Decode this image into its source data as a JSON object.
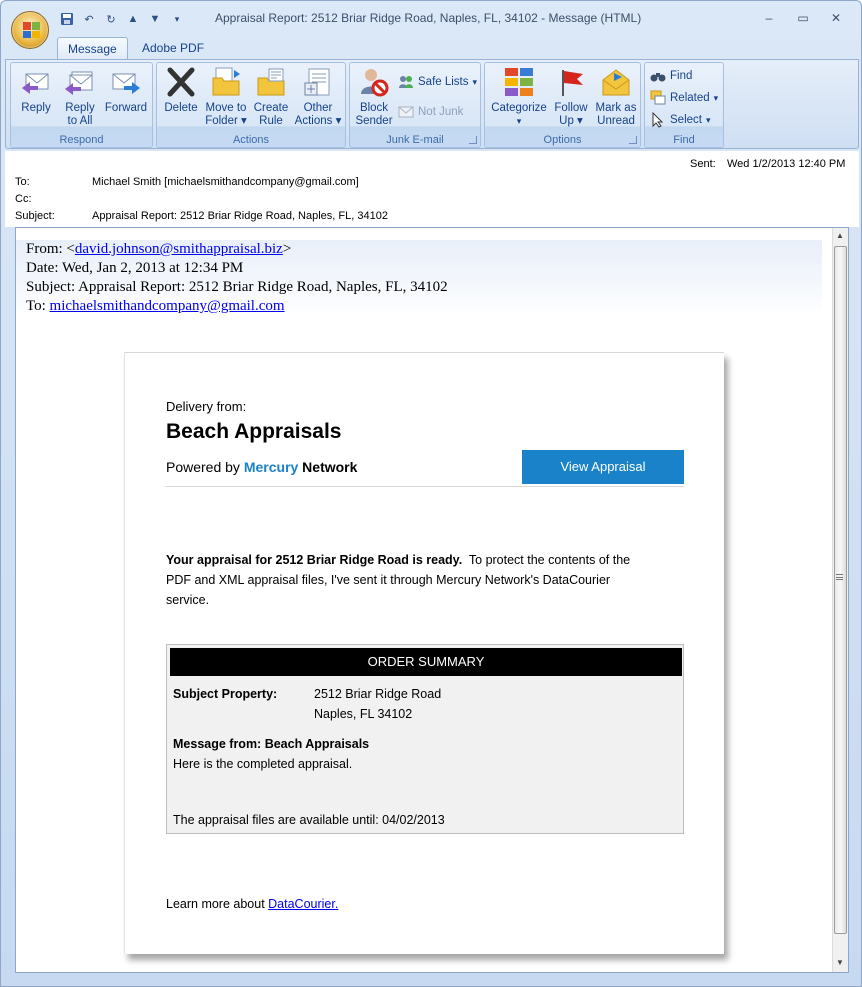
{
  "window": {
    "title": "Appraisal Report: 2512 Briar Ridge Road, Naples, FL, 34102 - Message (HTML)",
    "controls": {
      "minimize": "–",
      "maximize": "▭",
      "close": "✕"
    }
  },
  "tabs": [
    {
      "label": "Message"
    },
    {
      "label": "Adobe PDF"
    }
  ],
  "ribbon": {
    "respond": {
      "label": "Respond",
      "reply": "Reply",
      "reply_all_1": "Reply",
      "reply_all_2": "to All",
      "forward": "Forward"
    },
    "actions": {
      "label": "Actions",
      "delete": "Delete",
      "move_1": "Move to",
      "move_2": "Folder",
      "rule_1": "Create",
      "rule_2": "Rule",
      "other_1": "Other",
      "other_2": "Actions"
    },
    "junk": {
      "label": "Junk E-mail",
      "block_1": "Block",
      "block_2": "Sender",
      "safe_lists": "Safe Lists",
      "not_junk": "Not Junk"
    },
    "options": {
      "label": "Options",
      "categorize": "Categorize",
      "follow_1": "Follow",
      "follow_2": "Up",
      "mark_1": "Mark as",
      "mark_2": "Unread"
    },
    "find": {
      "label": "Find",
      "find": "Find",
      "related": "Related",
      "select": "Select"
    }
  },
  "header": {
    "sent_label": "Sent:",
    "sent_value": "Wed 1/2/2013 12:40 PM",
    "to_label": "To:",
    "to_value": "Michael Smith [michaelsmithandcompany@gmail.com]",
    "cc_label": "Cc:",
    "cc_value": "",
    "subject_label": "Subject:",
    "subject_value": "Appraisal Report: 2512 Briar Ridge Road, Naples, FL, 34102"
  },
  "forwarded": {
    "from_prefix": "From: <",
    "from_email": "david.johnson@smithappraisal.biz",
    "from_suffix": ">",
    "date": "Date: Wed, Jan 2, 2013 at 12:34 PM",
    "subject": "Subject: Appraisal Report: 2512 Briar Ridge Road, Naples, FL, 34102",
    "to_prefix": "To: ",
    "to_email": "michaelsmithandcompany@gmail.com"
  },
  "card": {
    "delivery_from": "Delivery from:",
    "company": "Beach Appraisals",
    "powered_by": "Powered by ",
    "brand_mercury": "Mercury",
    "brand_network": " Network",
    "view_button": "View Appraisal",
    "intro_bold": "Your appraisal for 2512 Briar Ridge Road is ready.",
    "intro_rest_1": "  To protect the contents of the",
    "intro_line_2": "PDF and XML appraisal files, I've sent it through Mercury Network's DataCourier",
    "intro_line_3": "service.",
    "summary": {
      "header": "ORDER SUMMARY",
      "property_label": "Subject Property:",
      "property_line1": "2512 Briar Ridge Road",
      "property_line2": "Naples, FL 34102",
      "message_label": "Message from: Beach Appraisals",
      "message_text": "Here is the completed appraisal.",
      "availability": "The appraisal files are available until: 04/02/2013"
    },
    "learn_more": "Learn more about ",
    "learn_link": "DataCourier."
  },
  "colors": {
    "accent": "#1a82c9",
    "mercury": "#1a82c9",
    "ribbon_text": "#15428b"
  }
}
